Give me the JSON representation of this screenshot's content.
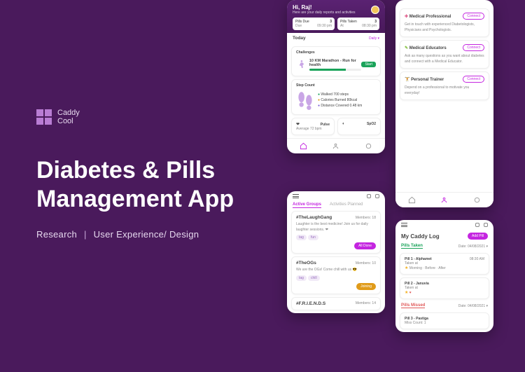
{
  "brand": {
    "line1": "Caddy",
    "line2": "Cool"
  },
  "title_l1": "Diabetes & Pills",
  "title_l2": "Management App",
  "subtitle_left": "Research",
  "subtitle_right": "User Experience/ Design",
  "separator": "|",
  "phone1": {
    "greeting": "Hi, Raj!",
    "greeting_sub": "Here are your daily reports and activities",
    "box1_title": "Pills Due",
    "box1_val": "3",
    "box1_sub": "09:30 pm",
    "box2_title": "Pills Taken",
    "box2_val": "3",
    "box2_sub": "08:30 pm",
    "today": "Today",
    "daily": "Daily ▾",
    "challenges": "Challenges",
    "run_title": "10 KM Marathon - Run for health",
    "run_btn": "Start",
    "stepcount": "Step Count",
    "walked": "Walked 700 steps",
    "calories": "Calories Burned 80kcal",
    "distance": "Distance Covered 0.48 km",
    "pulse_lbl": "Pulse",
    "pulse_val": "Average 72 bpm",
    "spo2_lbl": "SpO2"
  },
  "phone2": {
    "c1_title": "Medical Professional",
    "c1_btn": "Connect",
    "c1_body": "Get in touch with experienced Diabetologists, Physicians and Psychologists.",
    "c2_title": "Medical Educators",
    "c2_btn": "Connect",
    "c2_body": "Ask as many questions as you want about diabetes and connect with a Medical Educator.",
    "c3_title": "Personal Trainer",
    "c3_btn": "Connect",
    "c3_body": "Depend on a professional to motivate you everyday!"
  },
  "phone3": {
    "tab1": "Active Groups",
    "tab2": "Activities Planned",
    "g1_name": "#TheLaughGang",
    "g1_members": "Members: 18",
    "g1_body": "Laughter is the best medicine! Join us for daily laughter sessions. ❤",
    "g1_btn": "All Done",
    "g2_name": "#TheOGs",
    "g2_members": "Members: 10",
    "g2_body": "We are the OGs! Come chill with us 😎",
    "g2_btn": "Joining",
    "g3_name": "#F.R.I.E.N.D.S",
    "g3_members": "Members: 14"
  },
  "phone4": {
    "header": "My Caddy Log",
    "add": "Add Pill",
    "taken": "Pills Taken",
    "date1": "Date: 04/08/2021 ▾",
    "p1_name": "Pill 1 - Alphamet",
    "p1_time": "08:30 AM",
    "p1_status": "Taken at",
    "p2_name": "Pill 2 - Januvia",
    "p2_status": "Taken at",
    "missed": "Pills Missed",
    "date2": "Date: 04/08/2021 ▾",
    "p3_name": "Pill 3 - Pastiga",
    "p3_sub": "Miss Count: 1"
  }
}
